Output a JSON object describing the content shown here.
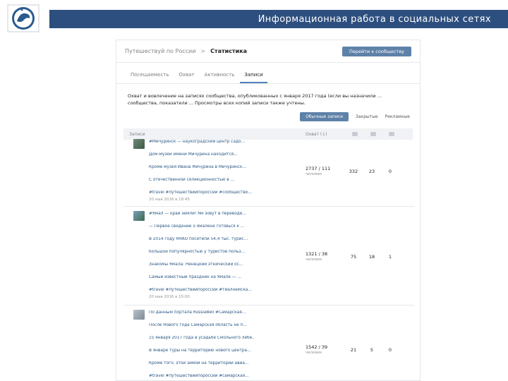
{
  "slide": {
    "title": "Информационная работа в социальных сетях"
  },
  "page": {
    "breadcrumb": {
      "group": "Путешествуй по России",
      "separator": ">",
      "current": "Статистика"
    },
    "go_button": "Перейти к сообществу",
    "tabs": [
      {
        "label": "Посещаемость",
        "active": false
      },
      {
        "label": "Охват",
        "active": false
      },
      {
        "label": "Активность",
        "active": false
      },
      {
        "label": "Записи",
        "active": true
      }
    ],
    "description": "Охват и вовлечение на записях сообщества, опубликованных с января 2017 года (если вы назначили … сообщества, показатели ... Просмотры всех копий записи также учтены.",
    "filters": [
      {
        "label": "Обычные записи",
        "active": true
      },
      {
        "label": "Закрытые",
        "active": false
      },
      {
        "label": "Рекламные",
        "active": false
      }
    ],
    "table_header": {
      "posts": "Записи",
      "coverage": "Охват (↓)"
    },
    "posts": [
      {
        "lines": [
          "#Мичуринск — наукоградский центр садо...",
          "Дом-музей имени Мичурина находится...",
          "Кроме музея Ивана Мичурина в Мичуринск...",
          "С отечественной селекционностью в ...",
          "#travel #путешествийпороссии #сообщество..."
        ],
        "date": "20 мая 2016 в 18:45",
        "coverage": "2737 / 111",
        "coverage_sub": "человек",
        "likes": "332",
        "reposts": "23",
        "comments": "0"
      },
      {
        "lines": [
          "#Ямал — край земли! Ям зовут в переводе...",
          "— Первое сведение о ямалене готовься к ...",
          "В 2014 году ЯНАО посетили 54,4 тыс. турис...",
          "большой популярностью у туристов польз...",
          "Знакомы Ямала: Ненецкий этнический ос...",
          "Самый известный праздник на Ямале — ...",
          "#travel #путешествийпороссии #тиалнемска..."
        ],
        "date": "20 мая 2016 в 15:00",
        "coverage": "1321 / 38",
        "coverage_sub": "человек",
        "likes": "75",
        "reposts": "18",
        "comments": "1"
      },
      {
        "lines": [
          "По данным портала RussiaBell #Самарская...",
          "После Нового года Самарская область не п...",
          "15 января 2017 года в усадьбе Смольного лебе...",
          "В январе туры на территорию нового центра...",
          "Кроме того, этой зимой на территории авиа...",
          "#travel #путешествийпороссии #самарская..."
        ],
        "date": "",
        "coverage": "1542 / 39",
        "coverage_sub": "человек",
        "likes": "21",
        "reposts": "5",
        "comments": "0"
      }
    ]
  },
  "colors": {
    "header_bar": "#2d4f7f",
    "button": "#5e81a8",
    "link": "#2a5885"
  },
  "icons": [
    "globe-logo-icon",
    "heart-icon",
    "repost-icon",
    "comment-icon"
  ]
}
